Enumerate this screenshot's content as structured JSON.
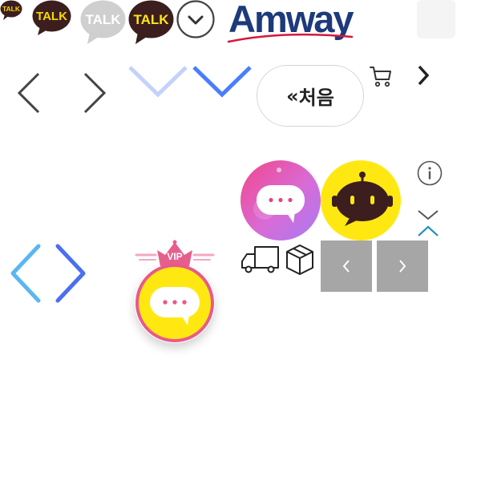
{
  "kakao": {
    "small_label": "TALK",
    "dark_label": "TALK",
    "gray_label": "TALK",
    "yellow_label": "TALK"
  },
  "brand": {
    "logo_text": "Amway"
  },
  "first_button": {
    "label": "처음",
    "icon_glyph": "«"
  },
  "vip": {
    "badge_label": "VIP"
  },
  "icons": {
    "dropdown": "chevron-down-circle-icon",
    "cart": "cart-icon",
    "info": "info-icon",
    "truck": "truck-icon",
    "box": "box-icon",
    "chatbot": "robot-icon"
  },
  "colors": {
    "kakao_dark": "#3c1e1e",
    "kakao_yellow": "#ffe812",
    "blue": "#4a7dff",
    "light_blue": "#5ab7f2",
    "pink": "#e85a8a",
    "amway_navy": "#1d3a7b",
    "amway_red": "#d6183a",
    "tile_gray": "#a6a6a6"
  }
}
